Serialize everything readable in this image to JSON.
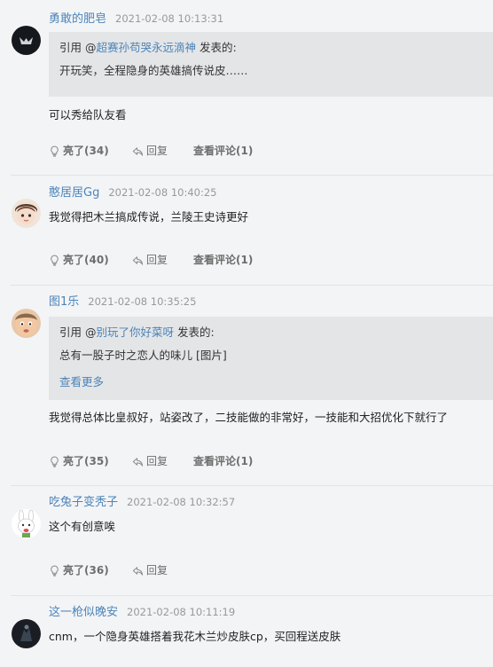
{
  "labels": {
    "quote_prefix": "引用 @",
    "quote_suffix": " 发表的:",
    "like": "亮了",
    "reply": "回复",
    "view_comments": "查看评论",
    "see_more": "查看更多"
  },
  "comments": [
    {
      "username": "勇敢的肥皂",
      "time": "2021-02-08 10:13:31",
      "quote_user": "超赛孙苟哭永远滴神",
      "quote_text": "开玩笑，全程隐身的英雄搞传说皮……",
      "text": "可以秀给队友看",
      "likes": "(34)",
      "comment_count": "(1)"
    },
    {
      "username": "憨居居Gg",
      "time": "2021-02-08 10:40:25",
      "text": "我觉得把木兰搞成传说，兰陵王史诗更好",
      "likes": "(40)",
      "comment_count": "(1)"
    },
    {
      "username": "图1乐",
      "time": "2021-02-08 10:35:25",
      "quote_user": "别玩了你好菜呀",
      "quote_text": "总有一股子时之恋人的味儿 [图片]",
      "text": "我觉得总体比皇叔好，站姿改了，二技能做的非常好，一技能和大招优化下就行了",
      "likes": "(35)",
      "comment_count": "(1)"
    },
    {
      "username": "吃兔子变秃子",
      "time": "2021-02-08 10:32:57",
      "text": "这个有创意唉",
      "likes": "(36)"
    },
    {
      "username": "这一枪似晚安",
      "time": "2021-02-08 10:11:19",
      "text": "cnm，一个隐身英雄搭着我花木兰炒皮肤cp，买回程送皮肤"
    }
  ],
  "colors": {
    "link": "#4c84b8",
    "timestamp": "#999999",
    "quote_bg": "#e4e5e7",
    "page_bg": "#f3f4f6"
  }
}
